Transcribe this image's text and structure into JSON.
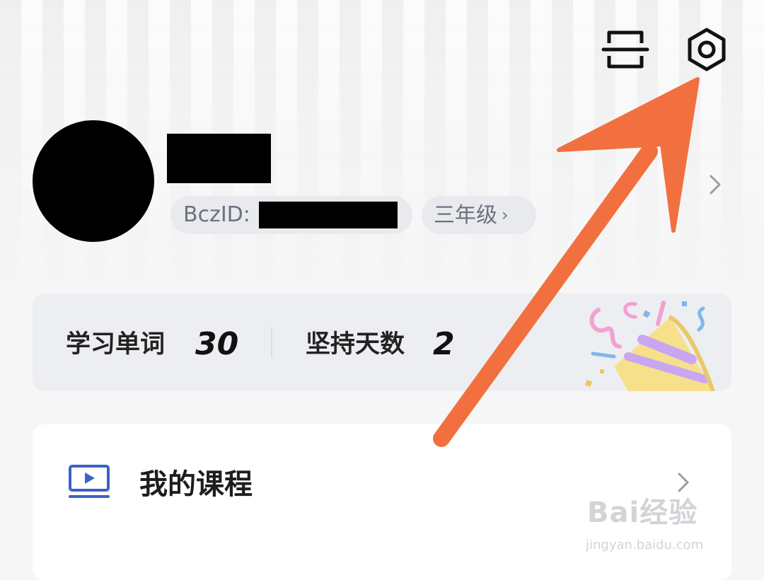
{
  "profile": {
    "id_prefix": "BczID:",
    "grade_label": "三年级",
    "grade_chevron": "›"
  },
  "stats": {
    "words_label": "学习单词",
    "words_value": "30",
    "days_label": "坚持天数",
    "days_value": "2"
  },
  "menu": {
    "courses_label": "我的课程"
  },
  "watermark": {
    "text": "Bai经验",
    "url": "jingyan.baidu.com"
  },
  "colors": {
    "annotation_arrow": "#f2703f",
    "course_icon": "#3c62c8",
    "chip_background": "#e9eaee"
  },
  "icons": {
    "scan": "scan-icon",
    "settings": "settings-hexagon-icon",
    "course": "video-course-icon",
    "chevron": "chevron-right-icon"
  }
}
